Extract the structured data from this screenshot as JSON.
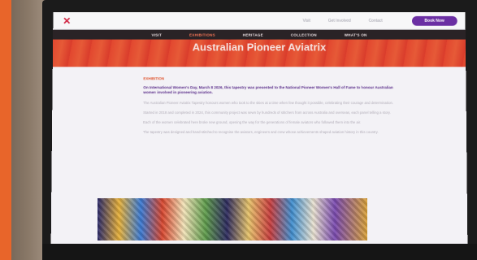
{
  "header": {
    "util_links": [
      "Visit",
      "Get Involved",
      "Contact"
    ],
    "book_label": "Book Now"
  },
  "nav": {
    "items": [
      "VISIT",
      "EXHIBITIONS",
      "HERITAGE",
      "COLLECTION",
      "WHAT'S ON"
    ]
  },
  "hero": {
    "title": "Australian Pioneer Aviatrix"
  },
  "article": {
    "eyebrow": "EXHIBITION",
    "lead": "On International Women's Day, March 8 2026, this tapestry was presented to the National Pioneer Women's Hall of Fame to honour Australian women involved in pioneering aviation.",
    "paragraphs": [
      "The Australian Pioneer Aviatrix Tapestry honours women who took to the skies at a time when few thought it possible, celebrating their courage and determination.",
      "Started in 2018 and completed in 2024, this community project was sewn by hundreds of stitchers from across Australia and overseas, each panel telling a story.",
      "Each of the women celebrated here broke new ground, opening the way for the generations of female aviators who followed them into the air.",
      "The tapestry was designed and hand-stitched to recognise the aviators, engineers and crew whose achievements shaped aviation history in this country."
    ]
  },
  "colors": {
    "accent": "#e0552e",
    "brand_purple": "#6b2fa3",
    "nav_bg": "#2a2326"
  },
  "icons": {
    "logo": "aviatrix-logo-icon"
  }
}
